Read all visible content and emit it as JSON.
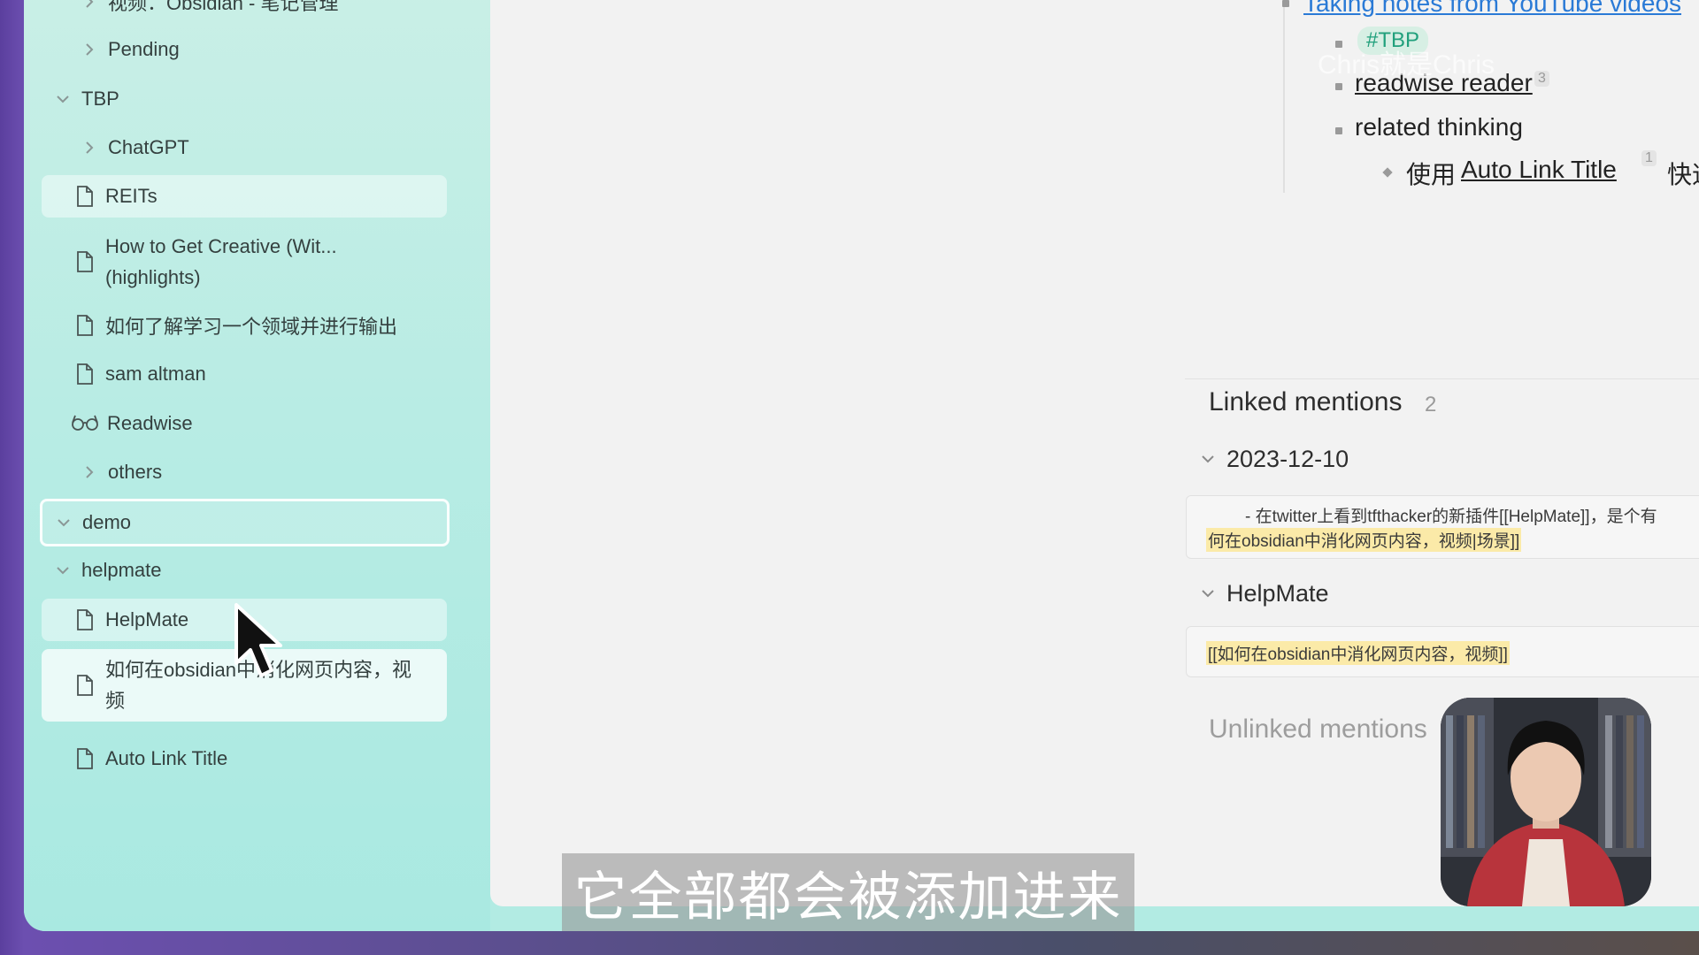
{
  "sidebar": {
    "items": [
      {
        "label": "视频：Obsidian - 笔记管理",
        "type": "folder-collapsed"
      },
      {
        "label": "Pending",
        "type": "folder-collapsed"
      },
      {
        "label": "TBP",
        "type": "folder-expanded"
      },
      {
        "label": "ChatGPT",
        "type": "folder-collapsed"
      },
      {
        "label": "REITs",
        "type": "file"
      },
      {
        "label": "How to Get Creative (Wit...",
        "label2": "(highlights)",
        "type": "file"
      },
      {
        "label": "如何了解学习一个领域并进行输出",
        "type": "file"
      },
      {
        "label": "sam altman",
        "type": "file"
      },
      {
        "label": "Readwise",
        "type": "glasses"
      },
      {
        "label": "others",
        "type": "folder-collapsed"
      },
      {
        "label": "demo",
        "type": "folder-expanded"
      },
      {
        "label": "helpmate",
        "type": "folder-expanded"
      },
      {
        "label": "HelpMate",
        "type": "file"
      },
      {
        "label": "如何在obsidian中消化网页内容，视",
        "label2": "频",
        "type": "file"
      },
      {
        "label": "Auto Link Title",
        "type": "file"
      }
    ]
  },
  "note": {
    "top_link": "Taking notes from YouTube videos",
    "tag": "#TBP",
    "readwise_link": "readwise reader",
    "readwise_count": "3",
    "related": "related thinking",
    "sub_prefix": "使用",
    "sub_link": "Auto Link Title",
    "sub_count": "1",
    "sub_suffix": "快速",
    "watermark": "Chris就是Chris"
  },
  "backlinks": {
    "linked_title": "Linked mentions",
    "linked_count": "2",
    "group1_title": "2023-12-10",
    "group1_line1": "- 在twitter上看到tfthacker的新插件[[HelpMate]]，是个有",
    "group1_line2": "何在obsidian中消化网页内容，视频|场景]]",
    "group2_title": "HelpMate",
    "group2_line1": "[[如何在obsidian中消化网页内容，视频]]",
    "unlinked_title": "Unlinked mentions"
  },
  "subtitle": "它全部都会被添加进来",
  "colors": {
    "accent_link": "#1aa88a",
    "sidebar_bg": "#b8ece4",
    "highlight": "#fbeaa8"
  }
}
